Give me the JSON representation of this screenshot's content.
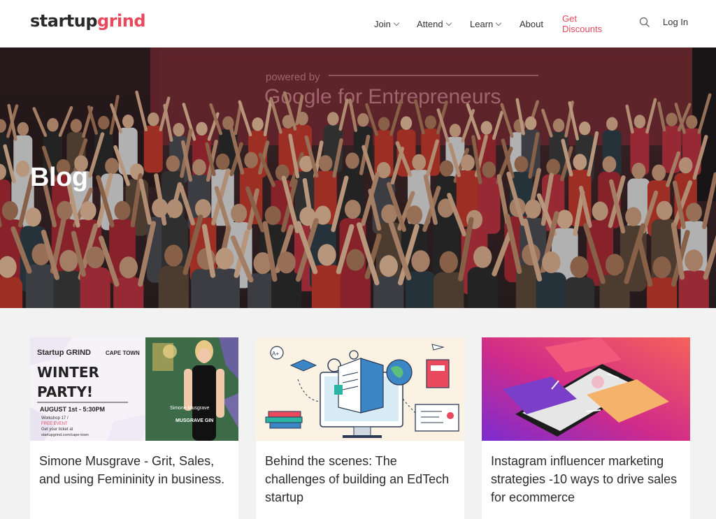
{
  "header": {
    "logo_part1": "startup",
    "logo_part2": "grind",
    "nav": {
      "join": "Join",
      "attend": "Attend",
      "learn": "Learn",
      "about": "About",
      "discounts": "Get Discounts"
    },
    "login": "Log In"
  },
  "hero": {
    "title": "Blog",
    "banner_line1": "powered by",
    "banner_line2": "Google for Entrepreneurs"
  },
  "colors": {
    "accent": "#e8495d",
    "text": "#2b2b2b",
    "background": "#f2f2f2"
  },
  "cards": [
    {
      "title": "Simone Musgrave - Grit, Sales, and using Femininity in business.",
      "image": {
        "brand": "Startup GRIND",
        "location": "CAPE TOWN",
        "headline1": "WINTER",
        "headline2": "PARTY!",
        "date": "AUGUST 1st - 5:30PM",
        "line1": "Workshop 17 /",
        "line2": "FREE EVENT",
        "line3": "Get your ticket at",
        "line4": "startupgrind.com/cape-town",
        "speaker_name": "Simone Musgrave",
        "speaker_brand": "MUSGRAVE GIN"
      }
    },
    {
      "title": "Behind the scenes: The challenges of building an EdTech startup",
      "image": {
        "badge": "A+"
      }
    },
    {
      "title": "Instagram influencer marketing strategies -10 ways to drive sales for ecommerce",
      "image": {}
    }
  ]
}
